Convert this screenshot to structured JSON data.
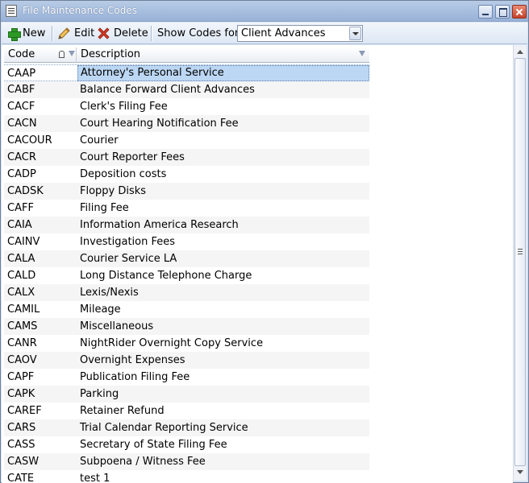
{
  "window": {
    "title": "File Maintenance Codes"
  },
  "toolbar": {
    "new_label": "New",
    "edit_label": "Edit",
    "delete_label": "Delete",
    "show_codes_label": "Show Codes for",
    "show_codes_value": "Client Advances"
  },
  "columns": {
    "code": "Code",
    "description": "Description"
  },
  "rows": [
    {
      "code": "CAAP",
      "description": "Attorney's Personal Service"
    },
    {
      "code": "CABF",
      "description": "Balance Forward Client Advances"
    },
    {
      "code": "CACF",
      "description": "Clerk's Filing Fee"
    },
    {
      "code": "CACN",
      "description": "Court Hearing Notification Fee"
    },
    {
      "code": "CACOUR",
      "description": "Courier"
    },
    {
      "code": "CACR",
      "description": "Court Reporter Fees"
    },
    {
      "code": "CADP",
      "description": "Deposition costs"
    },
    {
      "code": "CADSK",
      "description": "Floppy Disks"
    },
    {
      "code": "CAFF",
      "description": "Filing Fee"
    },
    {
      "code": "CAIA",
      "description": "Information America Research"
    },
    {
      "code": "CAINV",
      "description": "Investigation Fees"
    },
    {
      "code": "CALA",
      "description": "Courier Service LA"
    },
    {
      "code": "CALD",
      "description": "Long Distance Telephone Charge"
    },
    {
      "code": "CALX",
      "description": "Lexis/Nexis"
    },
    {
      "code": "CAMIL",
      "description": "Mileage"
    },
    {
      "code": "CAMS",
      "description": "Miscellaneous"
    },
    {
      "code": "CANR",
      "description": "NightRider Overnight Copy Service"
    },
    {
      "code": "CAOV",
      "description": "Overnight Expenses"
    },
    {
      "code": "CAPF",
      "description": "Publication Filing Fee"
    },
    {
      "code": "CAPK",
      "description": "Parking"
    },
    {
      "code": "CAREF",
      "description": "Retainer Refund"
    },
    {
      "code": "CARS",
      "description": "Trial Calendar Reporting Service"
    },
    {
      "code": "CASS",
      "description": "Secretary of State Filing Fee"
    },
    {
      "code": "CASW",
      "description": "Subpoena / Witness Fee"
    },
    {
      "code": "CATE",
      "description": "test 1"
    }
  ],
  "selected_row_index": 0,
  "colors": {
    "title_text": "#ffffff",
    "selection": "#bcd7f3",
    "add_icon": "#2e9a26",
    "delete_icon": "#d23a24"
  }
}
